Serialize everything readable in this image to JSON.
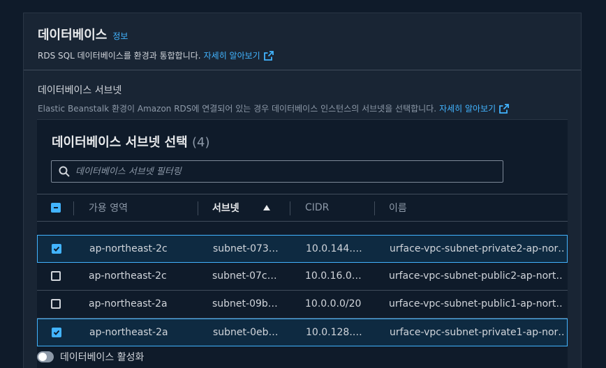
{
  "panel": {
    "title": "데이터베이스",
    "info_link": "정보",
    "description": "RDS SQL 데이터베이스를 환경과 통합합니다.",
    "learn_more": "자세히 알아보기"
  },
  "subnet_section": {
    "label": "데이터베이스 서브넷",
    "description": "Elastic Beanstalk 환경이 Amazon RDS에 연결되어 있는 경우 데이터베이스 인스턴스의 서브넷을 선택합니다.",
    "learn_more": "자세히 알아보기"
  },
  "table": {
    "title": "데이터베이스 서브넷 선택",
    "count": "(4)",
    "filter_placeholder": "데이터베이스 서브넷 필터링",
    "columns": {
      "az": "가용 영역",
      "subnet": "서브넷",
      "cidr": "CIDR",
      "name": "이름"
    },
    "sorted_column": "subnet",
    "sort_direction": "ascending",
    "rows": [
      {
        "selected": true,
        "az": "ap-northeast-2c",
        "subnet": "subnet-073…",
        "cidr": "10.0.144.…",
        "name": "urface-vpc-subnet-private2-ap-nor…"
      },
      {
        "selected": false,
        "az": "ap-northeast-2c",
        "subnet": "subnet-07c…",
        "cidr": "10.0.16.0…",
        "name": "urface-vpc-subnet-public2-ap-nort…"
      },
      {
        "selected": false,
        "az": "ap-northeast-2a",
        "subnet": "subnet-09b…",
        "cidr": "10.0.0.0/20",
        "name": "urface-vpc-subnet-public1-ap-nort…"
      },
      {
        "selected": true,
        "az": "ap-northeast-2a",
        "subnet": "subnet-0eb…",
        "cidr": "10.0.128.…",
        "name": "urface-vpc-subnet-private1-ap-nor…"
      }
    ]
  },
  "toggle": {
    "label": "데이터베이스 활성화",
    "enabled": false
  },
  "colors": {
    "accent": "#42b4ff",
    "background": "#0f1b2a",
    "panel": "#192534",
    "selected_row": "#0e2a41"
  }
}
